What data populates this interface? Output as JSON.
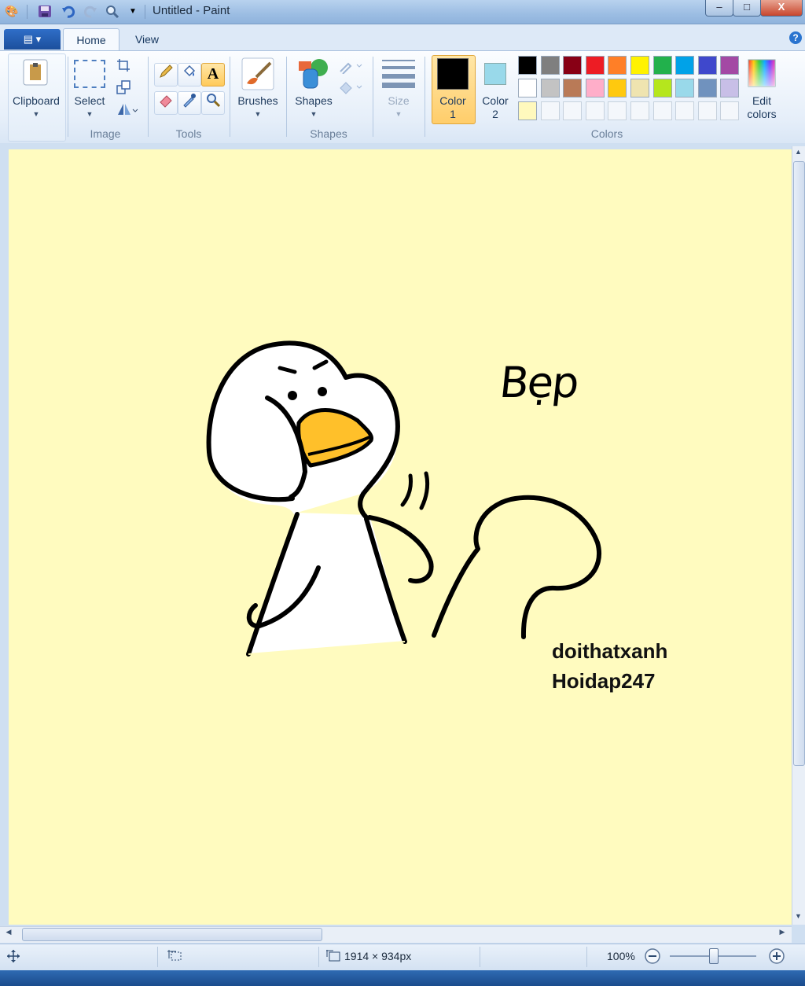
{
  "window": {
    "title": "Untitled - Paint",
    "controls": {
      "minimize": "–",
      "maximize": "□",
      "close": "X"
    }
  },
  "quick_access": [
    "paint-icon",
    "save-icon",
    "undo-icon",
    "redo-icon",
    "zoom-icon",
    "customize-dropdown-icon"
  ],
  "ribbon": {
    "tabs": [
      {
        "label": "Home",
        "active": true
      },
      {
        "label": "View",
        "active": false
      }
    ],
    "groups": {
      "clipboard": {
        "button_label": "Clipboard"
      },
      "image": {
        "label": "Image",
        "select_label": "Select"
      },
      "tools": {
        "label": "Tools"
      },
      "brushes": {
        "button_label": "Brushes"
      },
      "shapes": {
        "label": "Shapes",
        "button_label": "Shapes"
      },
      "size": {
        "button_label": "Size"
      },
      "colors": {
        "label": "Colors",
        "color1_label": "Color",
        "color1_num": "1",
        "color2_label": "Color",
        "color2_num": "2",
        "color1_value": "#000000",
        "color2_value": "#99d9ea",
        "edit_label_1": "Edit",
        "edit_label_2": "colors",
        "palette_row1": [
          "#000000",
          "#7f7f7f",
          "#880015",
          "#ed1c24",
          "#ff7f27",
          "#fff200",
          "#22b14c",
          "#00a2e8",
          "#3f48cc",
          "#a349a4"
        ],
        "palette_row2": [
          "#ffffff",
          "#c3c3c3",
          "#b97a57",
          "#ffaec9",
          "#ffc90e",
          "#efe4b0",
          "#b5e61d",
          "#99d9ea",
          "#7092be",
          "#c8bfe7"
        ],
        "palette_row3": [
          "#fff9bd",
          "",
          "",
          "",
          "",
          "",
          "",
          "",
          "",
          ""
        ]
      }
    }
  },
  "canvas": {
    "background": "#fffbbf",
    "texts": {
      "handwritten": "Bẹp",
      "line1": "doithatxanh",
      "line2": "Hoidap247"
    }
  },
  "statusbar": {
    "dimensions": "1914 × 934px",
    "zoom": "100%"
  }
}
